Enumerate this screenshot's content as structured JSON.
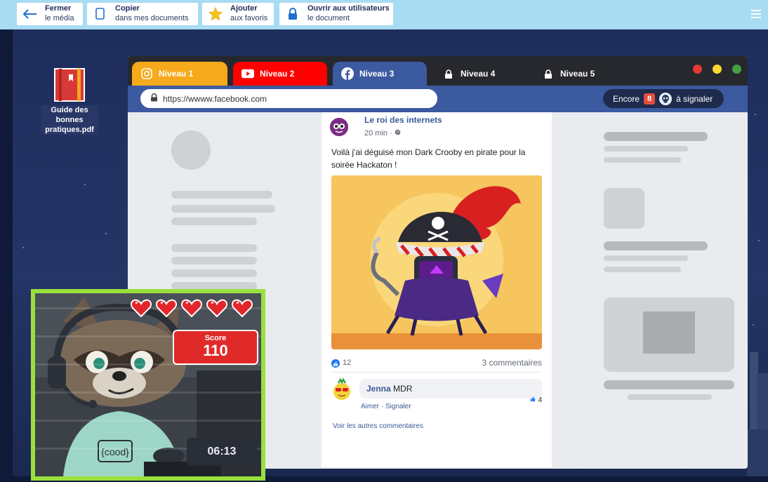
{
  "toolbar": {
    "close": {
      "title": "Fermer",
      "subtitle": "le média"
    },
    "copy": {
      "title": "Copier",
      "subtitle": "dans mes documents"
    },
    "favorite": {
      "title": "Ajouter",
      "subtitle": "aux favoris"
    },
    "open": {
      "title": "Ouvrir aux utilisateurs",
      "subtitle": "le document"
    }
  },
  "desktop": {
    "pdf_file": {
      "name": "Guide des bonnes pratiques.pdf",
      "lines": [
        "Guide des",
        "bonnes",
        "pratiques.pdf"
      ]
    }
  },
  "browser": {
    "tabs": [
      {
        "label": "Niveau 1",
        "icon": "instagram-icon",
        "color": "#f6a91a",
        "locked": false
      },
      {
        "label": "Niveau 2",
        "icon": "youtube-icon",
        "color": "#ff0000",
        "locked": false
      },
      {
        "label": "Niveau 3",
        "icon": "facebook-icon",
        "color": "#3c5aa0",
        "locked": false,
        "active": true
      },
      {
        "label": "Niveau 4",
        "icon": "lock-icon",
        "color": "#26282d",
        "locked": true
      },
      {
        "label": "Niveau 5",
        "icon": "lock-icon",
        "color": "#26282d",
        "locked": true
      }
    ],
    "url": "https://wwww.facebook.com",
    "report": {
      "prefix": "Encore",
      "count": "8",
      "suffix": "à signaler"
    },
    "window_buttons": [
      "#e53935",
      "#fdd835",
      "#43a047"
    ]
  },
  "post": {
    "author": "Le roi des internets",
    "time": "20 min · ",
    "text": "Voilà j'ai déguisé mon Dark Crooby en pirate pour la soirée Hackaton !",
    "likes": "12",
    "comments_count": "3 commentaires",
    "comment": {
      "name": "Jenna",
      "text": "MDR",
      "likes": "4",
      "actions": "Aimer · Signaler"
    },
    "more_comments": "Voir les autres commentaires"
  },
  "webcam": {
    "hearts": 5,
    "score_label": "Score",
    "score": "110",
    "timer": "06:13",
    "shirt_text": "{cood}"
  },
  "colors": {
    "toolbar_bg": "#a8dcf2",
    "facebook_blue": "#3c5aa0",
    "webcam_border": "#9ae03c",
    "score_red": "#e02a2a"
  }
}
